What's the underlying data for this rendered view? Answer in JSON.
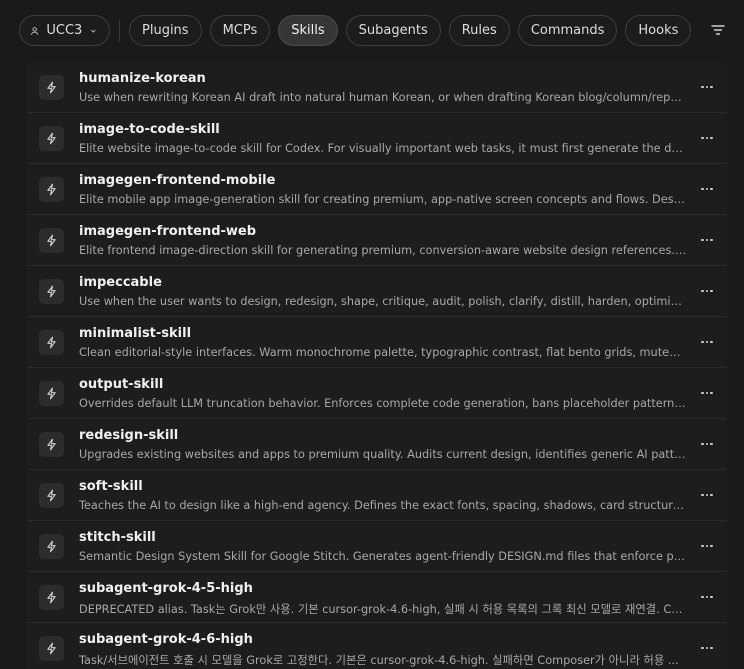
{
  "toolbar": {
    "workspace": "UCC3",
    "tabs": [
      {
        "label": "Plugins",
        "active": false
      },
      {
        "label": "MCPs",
        "active": false
      },
      {
        "label": "Skills",
        "active": true
      },
      {
        "label": "Subagents",
        "active": false
      },
      {
        "label": "Rules",
        "active": false
      },
      {
        "label": "Commands",
        "active": false
      },
      {
        "label": "Hooks",
        "active": false
      }
    ]
  },
  "skills": [
    {
      "name": "humanize-korean",
      "description": "Use when rewriting Korean AI draft into natural human Korean, or when drafting Korean blog/column/report cop..."
    },
    {
      "name": "image-to-code-skill",
      "description": "Elite website image-to-code skill for Codex. For visually important web tasks, it must first generate the design ima..."
    },
    {
      "name": "imagegen-frontend-mobile",
      "description": "Elite mobile app image-generation skill for creating premium, app-native screen concepts and flows. Designed fo..."
    },
    {
      "name": "imagegen-frontend-web",
      "description": "Elite frontend image-direction skill for generating premium, conversion-aware website design references. CRITIC..."
    },
    {
      "name": "impeccable",
      "description": "Use when the user wants to design, redesign, shape, critique, audit, polish, clarify, distill, harden, optimize, adapt, ..."
    },
    {
      "name": "minimalist-skill",
      "description": "Clean editorial-style interfaces. Warm monochrome palette, typographic contrast, flat bento grids, muted pastels...."
    },
    {
      "name": "output-skill",
      "description": "Overrides default LLM truncation behavior. Enforces complete code generation, bans placeholder patterns, and h..."
    },
    {
      "name": "redesign-skill",
      "description": "Upgrades existing websites and apps to premium quality. Audits current design, identifies generic AI patterns, an..."
    },
    {
      "name": "soft-skill",
      "description": "Teaches the AI to design like a high-end agency. Defines the exact fonts, spacing, shadows, card structures, and a..."
    },
    {
      "name": "stitch-skill",
      "description": "Semantic Design System Skill for Google Stitch. Generates agent-friendly DESIGN.md files that enforce premium, ..."
    },
    {
      "name": "subagent-grok-4-5-high",
      "description": "DEPRECATED alias. Task는 Grok만 사용. 기본 cursor-grok-4.6-high, 실패 시 허용 목록의 그록 최신 모델로 재연결. Co..."
    },
    {
      "name": "subagent-grok-4-6-high",
      "description": "Task/서브에이전트 호출 시 모델을 Grok로 고정한다. 기본은 cursor-grok-4.6-high. 실패하면 Composer가 아니라 허용 ..."
    }
  ],
  "icons": {
    "workspace": "user-icon",
    "dropdown": "chevron-down-icon",
    "filter": "filter-icon",
    "skill": "lightning-icon",
    "more": "more-horizontal-icon"
  }
}
